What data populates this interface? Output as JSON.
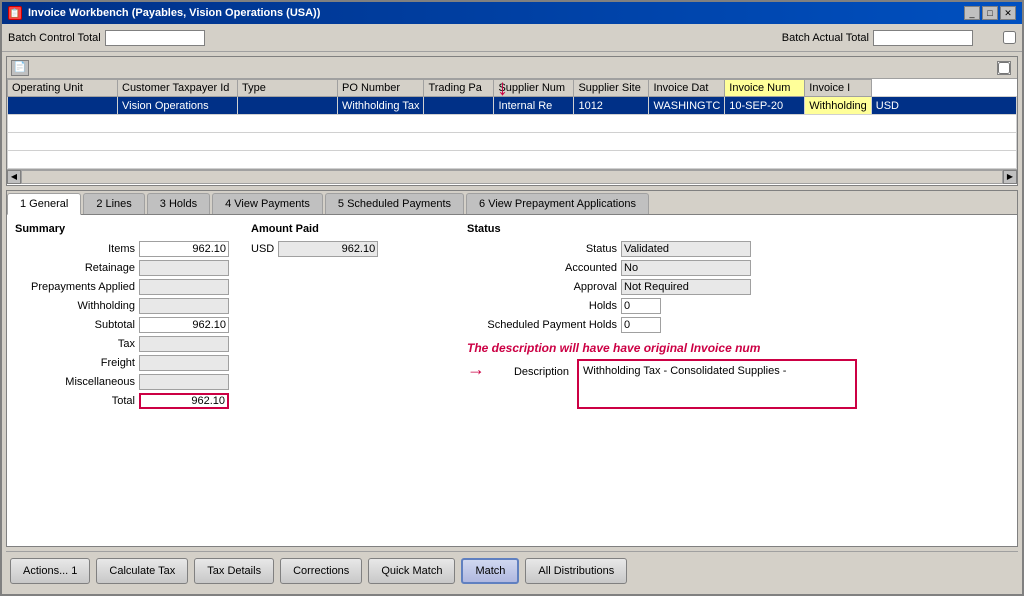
{
  "window": {
    "title": "Invoice Workbench (Payables, Vision Operations (USA))",
    "icon": "📋"
  },
  "toolbar": {
    "batch_control_label": "Batch Control Total",
    "batch_actual_label": "Batch Actual Total",
    "batch_control_value": "",
    "batch_actual_value": ""
  },
  "table": {
    "columns": [
      "Operating Unit",
      "Customer Taxpayer Id",
      "Type",
      "PO Number",
      "Trading Pa",
      "Supplier Num",
      "Supplier Site",
      "Invoice Dat",
      "Invoice Num",
      "Invoice I"
    ],
    "rows": [
      {
        "operating_unit": "Vision Operations",
        "customer_taxpayer": "",
        "type": "Withholding Tax",
        "po_number": "",
        "trading_partner": "Internal Re",
        "supplier_num": "1012",
        "supplier_site": "WASHINGTC",
        "invoice_date": "10-SEP-20",
        "invoice_num": "Withholding",
        "invoice_i": "USD"
      }
    ]
  },
  "tabs": [
    {
      "id": "general",
      "label": "1 General",
      "active": true
    },
    {
      "id": "lines",
      "label": "2 Lines",
      "active": false
    },
    {
      "id": "holds",
      "label": "3 Holds",
      "active": false
    },
    {
      "id": "view_payments",
      "label": "4 View Payments",
      "active": false
    },
    {
      "id": "scheduled_payments",
      "label": "5 Scheduled Payments",
      "active": false
    },
    {
      "id": "prepayment",
      "label": "6 View Prepayment Applications",
      "active": false
    }
  ],
  "general_tab": {
    "summary": {
      "title": "Summary",
      "fields": [
        {
          "label": "Items",
          "value": "962.10"
        },
        {
          "label": "Retainage",
          "value": ""
        },
        {
          "label": "Prepayments Applied",
          "value": ""
        },
        {
          "label": "Withholding",
          "value": ""
        },
        {
          "label": "Subtotal",
          "value": "962.10"
        },
        {
          "label": "Tax",
          "value": ""
        },
        {
          "label": "Freight",
          "value": ""
        },
        {
          "label": "Miscellaneous",
          "value": ""
        },
        {
          "label": "Total",
          "value": "962.10"
        }
      ]
    },
    "amount_paid": {
      "title": "Amount Paid",
      "currency": "USD",
      "value": "962.10"
    },
    "status": {
      "title": "Status",
      "fields": [
        {
          "label": "Status",
          "value": "Validated"
        },
        {
          "label": "Accounted",
          "value": "No"
        },
        {
          "label": "Approval",
          "value": "Not Required"
        },
        {
          "label": "Holds",
          "value": "0"
        },
        {
          "label": "Scheduled Payment Holds",
          "value": "0"
        }
      ]
    },
    "annotation": "The description will have have original Invoice num",
    "description_label": "Description",
    "description_value": "Withholding Tax - Consolidated Supplies -"
  },
  "bottom_buttons": [
    {
      "id": "actions",
      "label": "Actions... 1",
      "active": false
    },
    {
      "id": "calculate_tax",
      "label": "Calculate Tax",
      "active": false
    },
    {
      "id": "tax_details",
      "label": "Tax Details",
      "active": false
    },
    {
      "id": "corrections",
      "label": "Corrections",
      "active": false
    },
    {
      "id": "quick_match",
      "label": "Quick Match",
      "active": false
    },
    {
      "id": "match",
      "label": "Match",
      "active": true
    },
    {
      "id": "all_distributions",
      "label": "All Distributions",
      "active": false
    }
  ],
  "title_buttons": {
    "minimize": "_",
    "maximize": "□",
    "close": "✕"
  }
}
